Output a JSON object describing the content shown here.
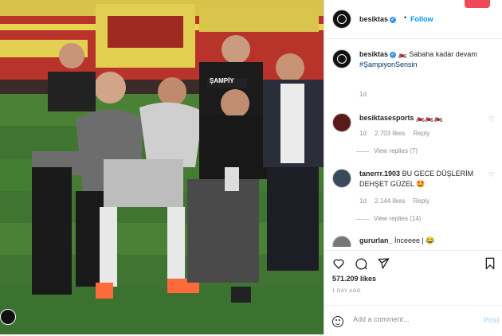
{
  "post": {
    "username": "besiktas",
    "follow_label": "Follow",
    "dot": "•"
  },
  "caption": {
    "username": "besiktas",
    "text": "🏍️ Sabaha kadar devam",
    "hashtag": "#ŞampiyonSensin",
    "age": "1d"
  },
  "comments": [
    {
      "username": "besiktasesports",
      "text": "🏍️🏍️🏍️",
      "age": "1d",
      "likes": "2.703 likes",
      "reply_label": "Reply",
      "view_replies": "View replies (7)"
    },
    {
      "username": "tanerrr.1903",
      "text": "BU GECE DÜŞLERİM DEHŞET GÜZEL 🤩",
      "age": "1d",
      "likes": "2.144 likes",
      "reply_label": "Reply",
      "view_replies": "View replies (14)"
    },
    {
      "username": "gururlan_",
      "text": "İnceeee | 😂"
    }
  ],
  "engagement": {
    "likes": "571.209 likes",
    "time_ago": "1 DAY AGO"
  },
  "comment_box": {
    "placeholder": "Add a comment...",
    "post_label": "Post"
  },
  "photo": {
    "banner_text": "ŞAMPİYON",
    "shirt_text": "ŞAMPİY"
  },
  "icons": {
    "like": "heart-icon",
    "comment": "comment-icon",
    "share": "share-icon",
    "save": "bookmark-icon",
    "emoji": "emoji-icon",
    "comment_like": "heart-icon"
  },
  "colors": {
    "accent": "#0095f6",
    "verified": "#3897f0",
    "pitch": "#3d6b2e"
  }
}
